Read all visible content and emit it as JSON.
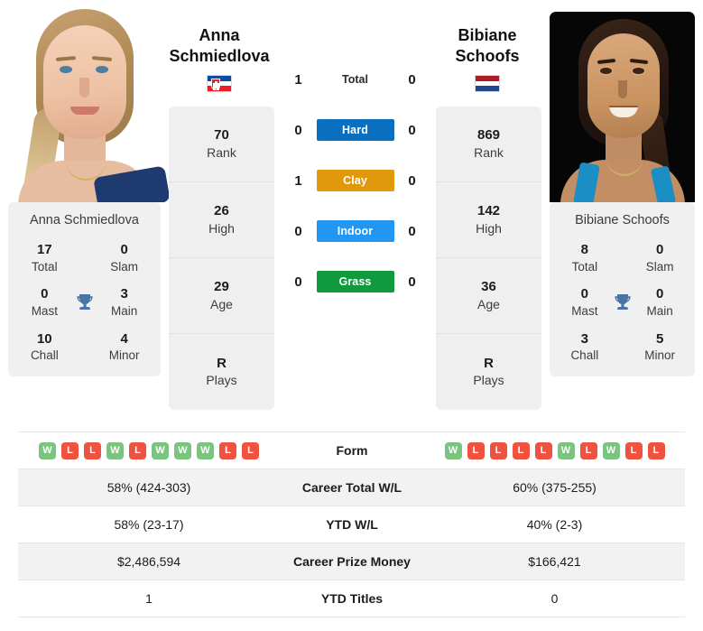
{
  "players": {
    "left": {
      "first_name": "Anna",
      "last_name": "Schmiedlova",
      "full_name": "Anna Schmiedlova",
      "country": "Slovakia",
      "flag_icon": "flag-slovakia-icon",
      "profile": [
        {
          "value": "70",
          "label": "Rank"
        },
        {
          "value": "26",
          "label": "High"
        },
        {
          "value": "29",
          "label": "Age"
        },
        {
          "value": "R",
          "label": "Plays"
        }
      ],
      "titles": {
        "total": "17",
        "total_label": "Total",
        "slam": "0",
        "slam_label": "Slam",
        "mast": "0",
        "mast_label": "Mast",
        "main": "3",
        "main_label": "Main",
        "chall": "10",
        "chall_label": "Chall",
        "minor": "4",
        "minor_label": "Minor"
      },
      "form": [
        "W",
        "L",
        "L",
        "W",
        "L",
        "W",
        "W",
        "W",
        "L",
        "L"
      ],
      "career_total_wl": "58% (424-303)",
      "ytd_wl": "58% (23-17)",
      "career_prize_money": "$2,486,594",
      "ytd_titles": "1"
    },
    "right": {
      "first_name": "Bibiane",
      "last_name": "Schoofs",
      "full_name": "Bibiane Schoofs",
      "country": "Netherlands",
      "flag_icon": "flag-netherlands-icon",
      "profile": [
        {
          "value": "869",
          "label": "Rank"
        },
        {
          "value": "142",
          "label": "High"
        },
        {
          "value": "36",
          "label": "Age"
        },
        {
          "value": "R",
          "label": "Plays"
        }
      ],
      "titles": {
        "total": "8",
        "total_label": "Total",
        "slam": "0",
        "slam_label": "Slam",
        "mast": "0",
        "mast_label": "Mast",
        "main": "0",
        "main_label": "Main",
        "chall": "3",
        "chall_label": "Chall",
        "minor": "5",
        "minor_label": "Minor"
      },
      "form": [
        "W",
        "L",
        "L",
        "L",
        "L",
        "W",
        "L",
        "W",
        "L",
        "L"
      ],
      "career_total_wl": "60% (375-255)",
      "ytd_wl": "40% (2-3)",
      "career_prize_money": "$166,421",
      "ytd_titles": "0"
    }
  },
  "head_to_head": {
    "rows": [
      {
        "key": "total",
        "label": "Total",
        "left": "1",
        "right": "0",
        "badge": false,
        "color": ""
      },
      {
        "key": "hard",
        "label": "Hard",
        "left": "0",
        "right": "0",
        "badge": true,
        "color": "#0b6fc1"
      },
      {
        "key": "clay",
        "label": "Clay",
        "left": "1",
        "right": "0",
        "badge": true,
        "color": "#e0990a"
      },
      {
        "key": "indoor",
        "label": "Indoor",
        "left": "0",
        "right": "0",
        "badge": true,
        "color": "#2196f3"
      },
      {
        "key": "grass",
        "label": "Grass",
        "left": "0",
        "right": "0",
        "badge": true,
        "color": "#11993e"
      }
    ]
  },
  "stats_table": {
    "rows": [
      {
        "key": "form",
        "label": "Form",
        "type": "form"
      },
      {
        "key": "career_wl",
        "label": "Career Total W/L",
        "type": "text",
        "left": "58% (424-303)",
        "right": "60% (375-255)"
      },
      {
        "key": "ytd_wl",
        "label": "YTD W/L",
        "type": "text",
        "left": "58% (23-17)",
        "right": "40% (2-3)"
      },
      {
        "key": "prize",
        "label": "Career Prize Money",
        "type": "text",
        "left": "$2,486,594",
        "right": "$166,421"
      },
      {
        "key": "ytd_titles",
        "label": "YTD Titles",
        "type": "text",
        "left": "1",
        "right": "0"
      }
    ]
  },
  "icons": {
    "trophy": "trophy-icon"
  },
  "colors": {
    "hard": "#0b6fc1",
    "clay": "#e0990a",
    "indoor": "#2196f3",
    "grass": "#11993e",
    "win": "#7bc47f",
    "loss": "#ef5340",
    "card_bg": "#f0f0f0"
  }
}
